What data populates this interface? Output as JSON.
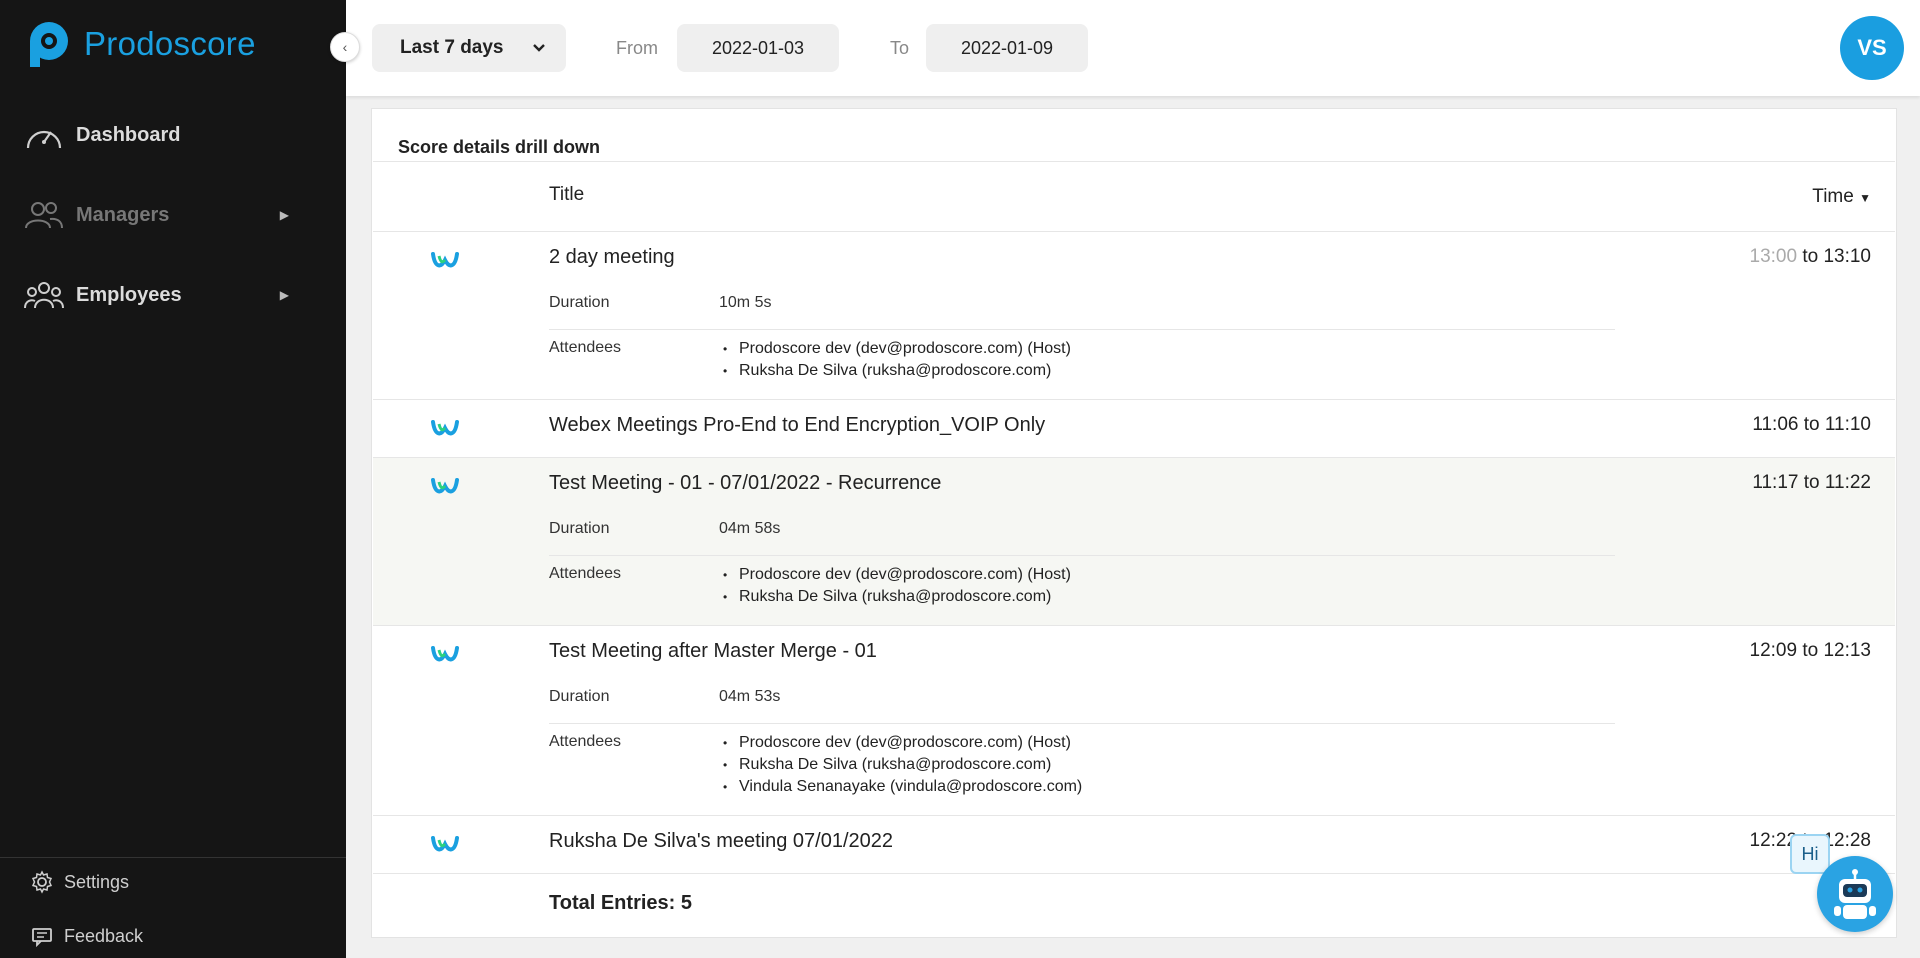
{
  "sidebar": {
    "logo_text": "Prodoscore",
    "nav": [
      {
        "label": "Dashboard"
      },
      {
        "label": "Managers"
      },
      {
        "label": "Employees"
      }
    ],
    "settings_label": "Settings",
    "feedback_label": "Feedback"
  },
  "header": {
    "range_label": "Last 7 days",
    "from_label": "From",
    "from_value": "2022-01-03",
    "to_label": "To",
    "to_value": "2022-01-09",
    "avatar_initials": "VS"
  },
  "panel": {
    "title": "Score details drill down",
    "columns": {
      "title": "Title",
      "time": "Time"
    },
    "duration_label": "Duration",
    "attendees_label": "Attendees",
    "rows": [
      {
        "title": "2 day meeting",
        "time_start": "13:00",
        "time_sep": " to ",
        "time_end": "13:10",
        "duration": "10m 5s",
        "attendees": [
          "Prodoscore dev (dev@prodoscore.com) (Host)",
          "Ruksha De Silva (ruksha@prodoscore.com)"
        ]
      },
      {
        "title": "Webex Meetings Pro-End to End Encryption_VOIP Only",
        "time": "11:06 to 11:10"
      },
      {
        "title": "Test Meeting - 01 - 07/01/2022 - Recurrence",
        "time": "11:17 to 11:22",
        "duration": "04m 58s",
        "attendees": [
          "Prodoscore dev (dev@prodoscore.com) (Host)",
          "Ruksha De Silva (ruksha@prodoscore.com)"
        ]
      },
      {
        "title": "Test Meeting after Master Merge - 01",
        "time": "12:09 to 12:13",
        "duration": "04m 53s",
        "attendees": [
          "Prodoscore dev (dev@prodoscore.com) (Host)",
          "Ruksha De Silva (ruksha@prodoscore.com)",
          "Vindula Senanayake (vindula@prodoscore.com)"
        ]
      },
      {
        "title": "Ruksha De Silva's meeting 07/01/2022",
        "time": "12:22 to 12:28"
      }
    ],
    "total_label": "Total Entries: 5"
  },
  "chatbot": {
    "greeting": "Hi"
  },
  "icons": {
    "dashboard": "speedometer-icon",
    "managers": "users-icon",
    "employees": "group-icon",
    "settings": "gear-icon",
    "feedback": "feedback-icon",
    "meeting_app": "webex-icon"
  },
  "colors": {
    "brand": "#1aa0e0",
    "sidebar_bg": "#151515",
    "highlight_row": "#f6f7f3"
  }
}
